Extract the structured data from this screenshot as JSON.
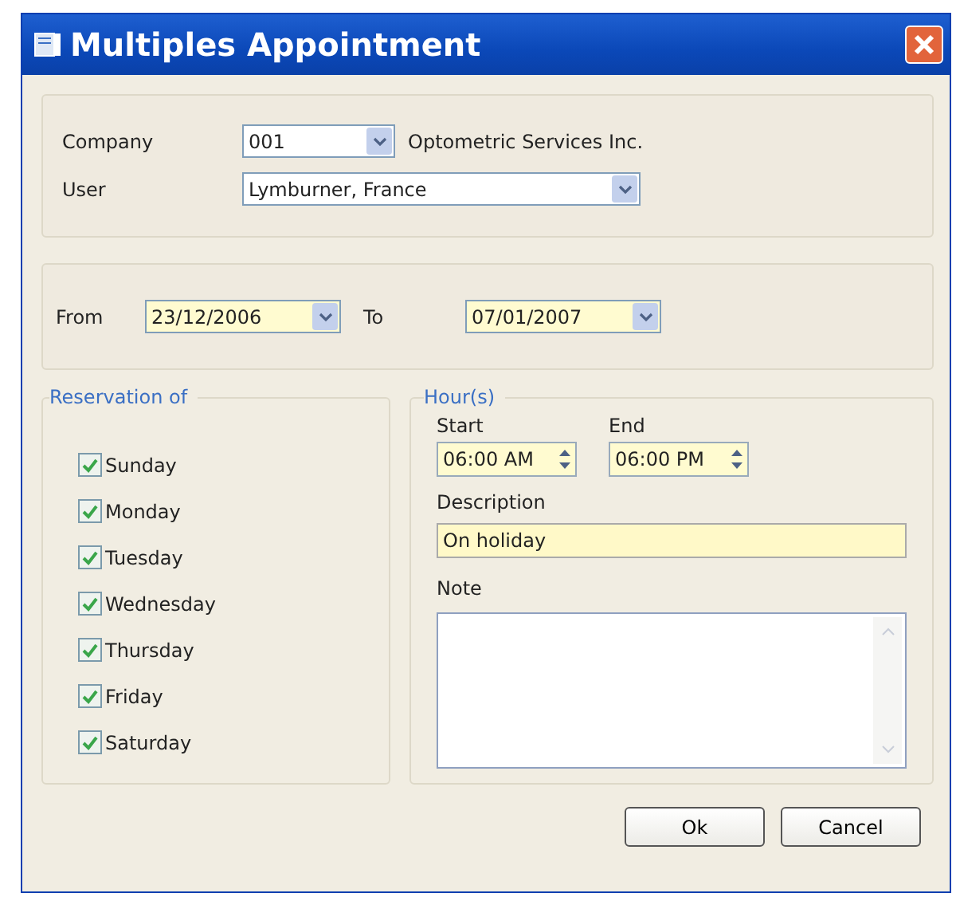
{
  "window": {
    "title": "Multiples Appointment"
  },
  "company": {
    "label": "Company",
    "value": "001",
    "name": "Optometric Services Inc."
  },
  "user": {
    "label": "User",
    "value": "Lymburner, France"
  },
  "dates": {
    "from_label": "From",
    "from": "23/12/2006",
    "to_label": "To",
    "to": "07/01/2007"
  },
  "reservation": {
    "title": "Reservation of",
    "days": [
      {
        "label": "Sunday",
        "checked": true
      },
      {
        "label": "Monday",
        "checked": true
      },
      {
        "label": "Tuesday",
        "checked": true
      },
      {
        "label": "Wednesday",
        "checked": true
      },
      {
        "label": "Thursday",
        "checked": true
      },
      {
        "label": "Friday",
        "checked": true
      },
      {
        "label": "Saturday",
        "checked": true
      }
    ]
  },
  "hours": {
    "title": "Hour(s)",
    "start_label": "Start",
    "start": "06:00 AM",
    "end_label": "End",
    "end": "06:00 PM",
    "description_label": "Description",
    "description": "On holiday",
    "note_label": "Note"
  },
  "buttons": [
    "Ok",
    "Cancel"
  ]
}
